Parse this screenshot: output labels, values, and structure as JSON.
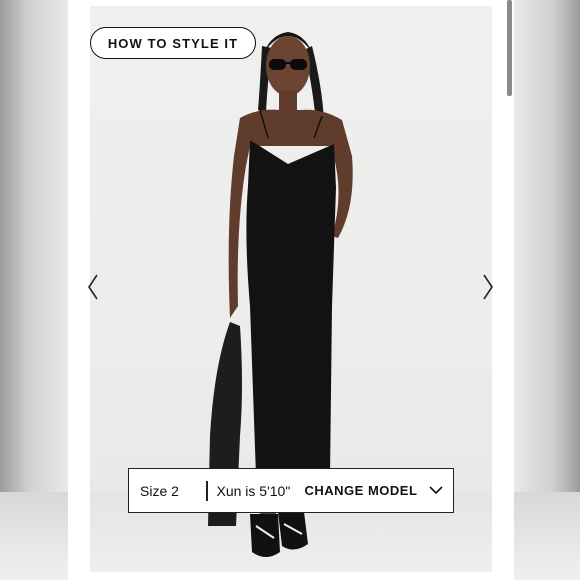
{
  "style_button": {
    "label": "HOW TO STYLE IT"
  },
  "model_info": {
    "size_label": "Size 2",
    "model_height": "Xun is 5'10\"",
    "change_model_label": "CHANGE MODEL"
  },
  "icons": {
    "prev": "chevron-left-icon",
    "next": "chevron-right-icon",
    "dropdown": "chevron-down-icon"
  },
  "colors": {
    "text": "#111111",
    "dress": "#121212",
    "background": "#ebebea"
  }
}
